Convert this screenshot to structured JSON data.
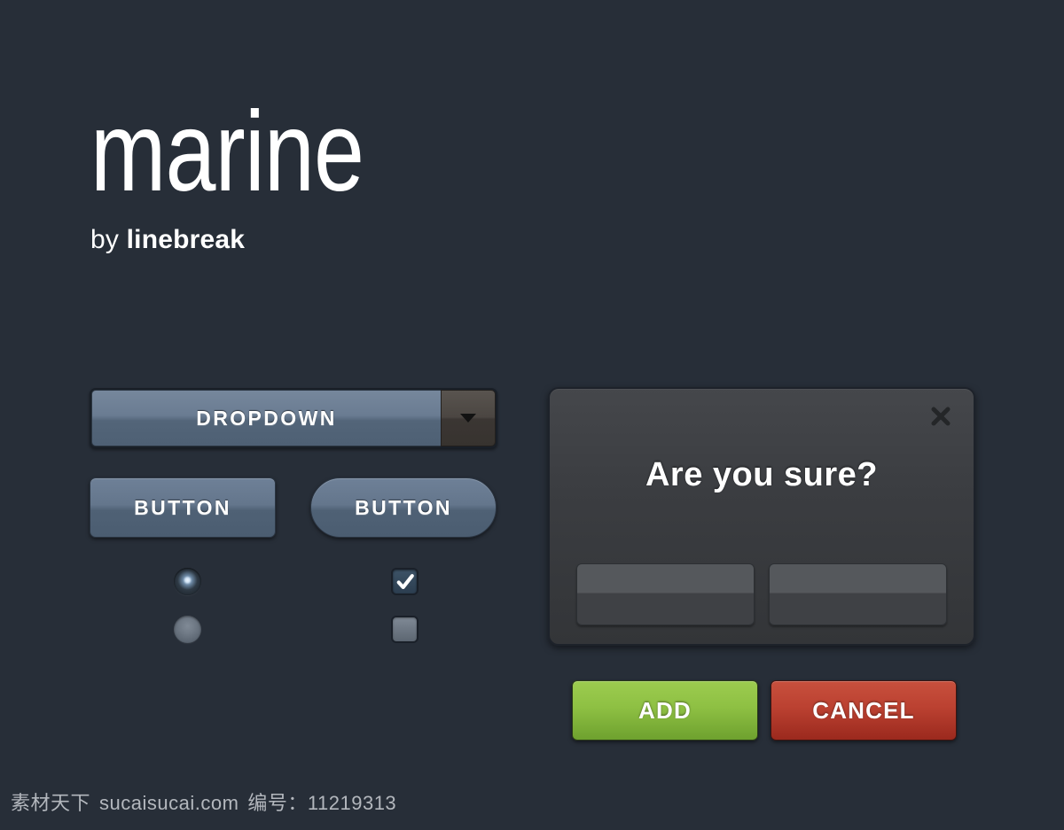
{
  "brand": {
    "title": "marine",
    "by_prefix": "by ",
    "author": "linebreak"
  },
  "controls": {
    "dropdown": {
      "label": "DROPDOWN",
      "arrow_icon": "chevron-down-icon"
    },
    "button_rect": "BUTTON",
    "button_pill": "BUTTON",
    "radio_group": {
      "selected_index": 0,
      "options": [
        "radio-selected",
        "radio-unselected"
      ]
    },
    "checkbox_group": {
      "states": [
        "checked",
        "unchecked"
      ]
    }
  },
  "dialog": {
    "title": "Are you sure?",
    "close_icon": "close-icon",
    "fields": [
      {
        "value": "",
        "placeholder": ""
      },
      {
        "value": "",
        "placeholder": ""
      }
    ]
  },
  "actions": {
    "confirm_label": "ADD",
    "cancel_label": "CANCEL"
  },
  "watermark": {
    "site_cn": "素材天下",
    "site_url": "sucaisucai.com",
    "id_label": "编号：",
    "id_value": "11219313"
  },
  "colors": {
    "background": "#272e38",
    "accent_blue": "#64768c",
    "dialog_body": "#3b3d41",
    "confirm_green": "#8ec043",
    "cancel_red": "#bb4131",
    "text_primary": "#ffffff"
  }
}
